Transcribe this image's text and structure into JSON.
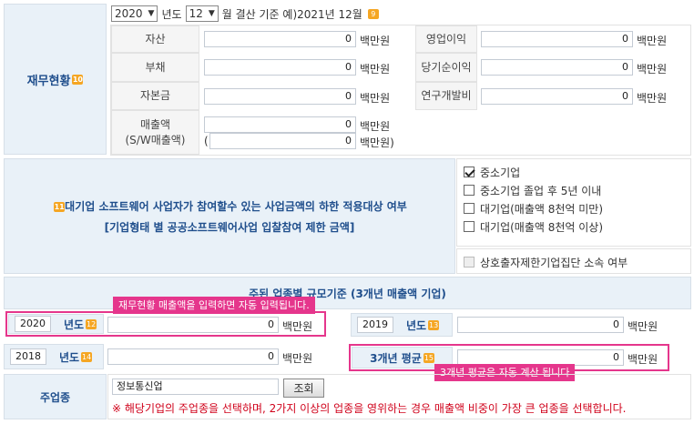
{
  "header_row": {
    "year": "2020",
    "year_suffix": "년도",
    "month": "12",
    "month_suffix": "월 결산 기준 예)2021년 12월",
    "badge": "9"
  },
  "financial": {
    "section_label": "재무현황",
    "section_badge": "10",
    "unit": "백만원",
    "rows": [
      {
        "left_label": "자산",
        "left_value": "0",
        "right_label": "영업이익",
        "right_value": "0"
      },
      {
        "left_label": "부채",
        "left_value": "0",
        "right_label": "당기순이익",
        "right_value": "0"
      },
      {
        "left_label": "자본금",
        "left_value": "0",
        "right_label": "연구개발비",
        "right_value": "0"
      }
    ],
    "sales_label_1": "매출액",
    "sales_label_2": "(S/W매출액)",
    "sales_value": "0",
    "sw_sales_value": "0",
    "paren_open": "(",
    "unit_close": "백만원)"
  },
  "limit_section": {
    "badge": "11",
    "title": "대기업 소프트웨어 사업자가 참여할수 있는 사업금액의 하한 적용대상 여부",
    "subtitle": "[기업형태 별 공공소프트웨어사업 입찰참여 제한 금액]",
    "options": [
      {
        "label": "중소기업",
        "checked": true
      },
      {
        "label": "중소기업 졸업 후 5년 이내",
        "checked": false
      },
      {
        "label": "대기업(매출액 8천억 미만)",
        "checked": false
      },
      {
        "label": "대기업(매출액 8천억 이상)",
        "checked": false
      }
    ],
    "mutual_label": "상호출자제한기업집단 소속 여부"
  },
  "scale": {
    "title": "주된 업종별 규모기준 (3개년 매출액 기업)",
    "tooltip_top": "재무현황 매출액을 입력하면 자동 입력됩니다.",
    "tooltip_bottom": "3개년 평균은 자동 계산 됩니다",
    "year_suffix": "년도",
    "unit": "백만원",
    "y2020": {
      "year": "2020",
      "badge": "12",
      "value": "0"
    },
    "y2019": {
      "year": "2019",
      "badge": "13",
      "value": "0"
    },
    "y2018": {
      "year": "2018",
      "badge": "14",
      "value": "0"
    },
    "avg": {
      "label": "3개년 평균",
      "badge": "15",
      "value": "0"
    }
  },
  "industry": {
    "label": "주업종",
    "value": "정보통신업",
    "button": "조회",
    "notice": "※ 해당기업의 주업종을 선택하며, 2가지 이상의 업종을 영위하는 경우 매출액 비중이 가장 큰 업종을 선택합니다."
  },
  "colors": {
    "label_bg": "#e9f1f8",
    "accent_pink": "#e5368c",
    "label_text": "#1f4e8c",
    "badge": "#f5a623",
    "notice_red": "#d0021b"
  }
}
